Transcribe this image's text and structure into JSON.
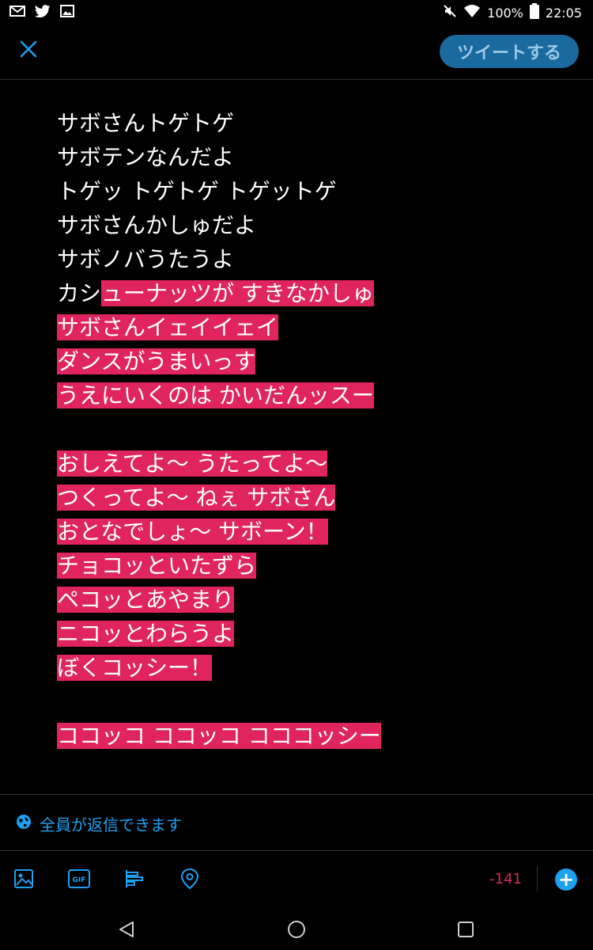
{
  "status_bar": {
    "battery": "100%",
    "time": "22:05",
    "left_icons": [
      "gmail-icon",
      "twitter-icon",
      "gallery-icon"
    ],
    "right_icons": [
      "mute-icon",
      "wifi-icon",
      "battery-icon"
    ]
  },
  "header": {
    "close_icon": "close-icon",
    "tweet_button": "ツイートする"
  },
  "compose": {
    "lines": [
      {
        "plain": "サボさんトゲトゲ",
        "hl": ""
      },
      {
        "plain": "サボテンなんだよ",
        "hl": ""
      },
      {
        "plain": "トゲッ トゲトゲ トゲットゲ",
        "hl": ""
      },
      {
        "plain": "サボさんかしゅだよ",
        "hl": ""
      },
      {
        "plain": "サボノバうたうよ",
        "hl": ""
      },
      {
        "plain": "カシ",
        "hl": "ューナッツが すきなかしゅ"
      },
      {
        "plain": "",
        "hl": "サボさんイェイイェイ"
      },
      {
        "plain": "",
        "hl": "ダンスがうまいっす"
      },
      {
        "plain": "",
        "hl": "うえにいくのは かいだんッスー"
      },
      {
        "plain": "",
        "hl": ""
      },
      {
        "plain": "",
        "hl": "おしえてよ～ うたってよ～"
      },
      {
        "plain": "",
        "hl": "つくってよ～ ねぇ サボさん"
      },
      {
        "plain": "",
        "hl": "おとなでしょ～ サボーン！"
      },
      {
        "plain": "",
        "hl": "チョコッといたずら"
      },
      {
        "plain": "",
        "hl": "ペコッとあやまり"
      },
      {
        "plain": "",
        "hl": "ニコッとわらうよ"
      },
      {
        "plain": "",
        "hl": "ぼくコッシー！"
      },
      {
        "plain": "",
        "hl": ""
      },
      {
        "plain": "",
        "hl": "ココッコ ココッコ コココッシー"
      }
    ],
    "highlight_color": "#e0245e"
  },
  "reply_setting": {
    "icon": "globe-icon",
    "label": "全員が返信できます"
  },
  "toolbar": {
    "icons": [
      "image-icon",
      "gif-icon",
      "poll-icon",
      "location-icon"
    ],
    "gif_label": "GIF",
    "counter": "-141",
    "counter_color": "#e0245e",
    "add_icon": "plus-icon",
    "add_label": "+"
  },
  "nav_bar": {
    "icons": [
      "back-icon",
      "home-icon",
      "recents-icon"
    ]
  },
  "colors": {
    "accent": "#1da1f2",
    "background": "#000000"
  }
}
